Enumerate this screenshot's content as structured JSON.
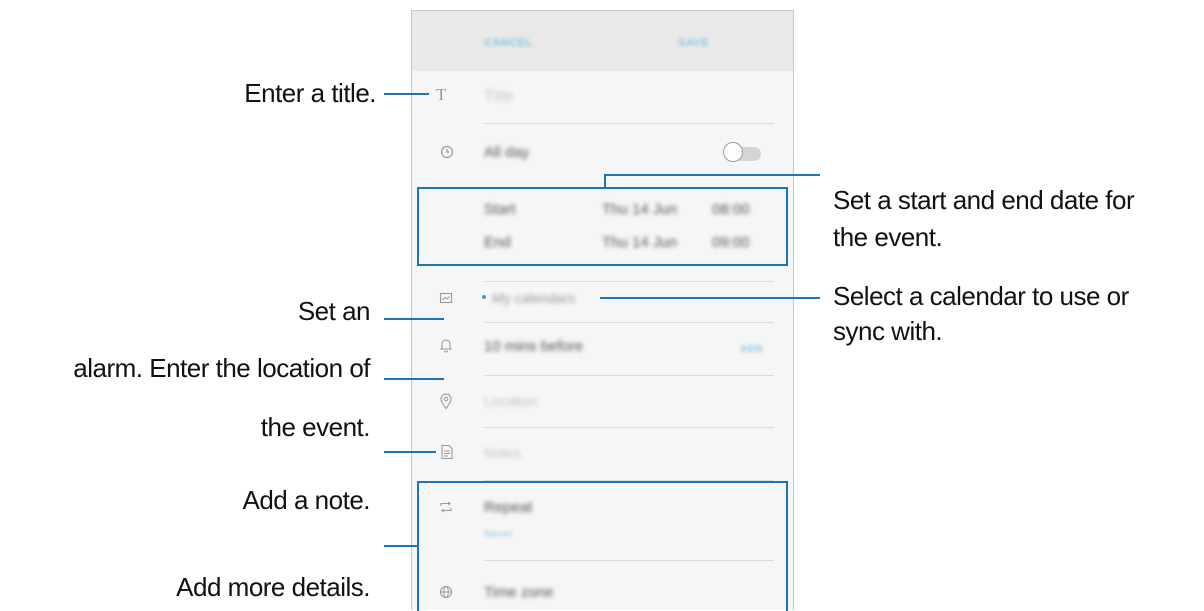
{
  "callouts": {
    "title": "Enter a title.",
    "date_line1": "Set a start and end date for",
    "date_line2": "the  event.",
    "calendar_line1": "Select a calendar to use or",
    "calendar_line2": "sync  with.",
    "alarm_line1": "Set an",
    "alarm_line2": "alarm.  Enter the location of",
    "location_line": "the event.",
    "note": "Add a note.",
    "details": "Add more details."
  },
  "screen": {
    "cancel_label": "CANCEL",
    "save_label": "SAVE",
    "title_placeholder": "Title",
    "all_day_label": "All day",
    "start_label": "Start",
    "start_date": "Thu 14 Jun",
    "start_time": "08:00",
    "end_label": "End",
    "end_date": "Thu 14 Jun",
    "end_time": "09:00",
    "calendar_label": "My calendars",
    "reminder_label": "10 mins before",
    "reminder_action": "ADD",
    "location_placeholder": "Location",
    "notes_placeholder": "Notes",
    "repeat_label": "Repeat",
    "repeat_value": "Never",
    "timezone_label": "Time zone"
  },
  "colors": {
    "callout_line": "#1b75b8",
    "accent": "#8cc4e6"
  },
  "icons": [
    "title-icon",
    "clock-icon",
    "calendar-icon",
    "bell-icon",
    "location-pin-icon",
    "note-icon",
    "repeat-icon",
    "globe-icon"
  ]
}
